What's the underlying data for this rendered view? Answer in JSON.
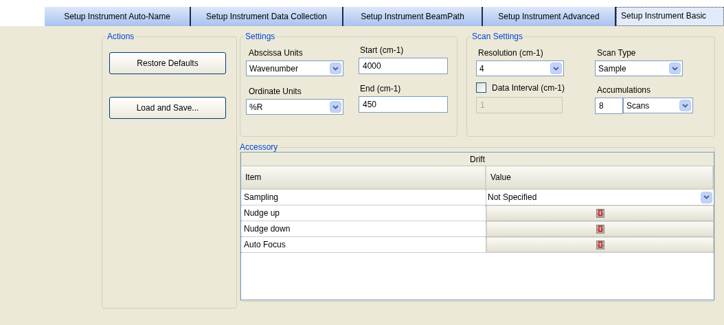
{
  "tabs": [
    {
      "label": "Setup Instrument Auto-Name",
      "selected": false
    },
    {
      "label": "Setup Instrument Data Collection",
      "selected": false
    },
    {
      "label": "Setup Instrument BeamPath",
      "selected": false
    },
    {
      "label": "Setup Instrument Advanced",
      "selected": false
    },
    {
      "label": "Setup Instrument Basic",
      "selected": true
    }
  ],
  "actions": {
    "title": "Actions",
    "buttons": [
      "Restore Defaults",
      "Load and Save..."
    ]
  },
  "settings": {
    "title": "Settings",
    "fields": [
      {
        "kind": "select",
        "label": "Abscissa Units",
        "value": "Wavenumber"
      },
      {
        "kind": "input",
        "label": "Start (cm-1)",
        "value": "4000"
      },
      {
        "kind": "select",
        "label": "Ordinate Units",
        "value": "%R"
      },
      {
        "kind": "input",
        "label": "End (cm-1)",
        "value": "450"
      }
    ]
  },
  "scan_settings": {
    "title": "Scan Settings",
    "fields": [
      {
        "kind": "select",
        "label": "Resolution (cm-1)",
        "value": "4"
      },
      {
        "kind": "select",
        "label": "Scan Type",
        "value": "Sample"
      },
      {
        "kind": "checkbox",
        "label": "Data Interval (cm-1)",
        "checked": false,
        "value": "1",
        "disabled": true
      },
      {
        "kind": "combo",
        "label": "Accumulations",
        "value": "8",
        "unit": "Scans"
      }
    ]
  },
  "accessory": {
    "title": "Accessory",
    "table": {
      "caption": "Drift",
      "columns": [
        "Item",
        "Value"
      ],
      "rows": [
        {
          "item": "Sampling",
          "kind": "select",
          "value": "Not Specified"
        },
        {
          "item": "Nudge up",
          "kind": "button"
        },
        {
          "item": "Nudge down",
          "kind": "button"
        },
        {
          "item": "Auto Focus",
          "kind": "button"
        }
      ]
    }
  }
}
